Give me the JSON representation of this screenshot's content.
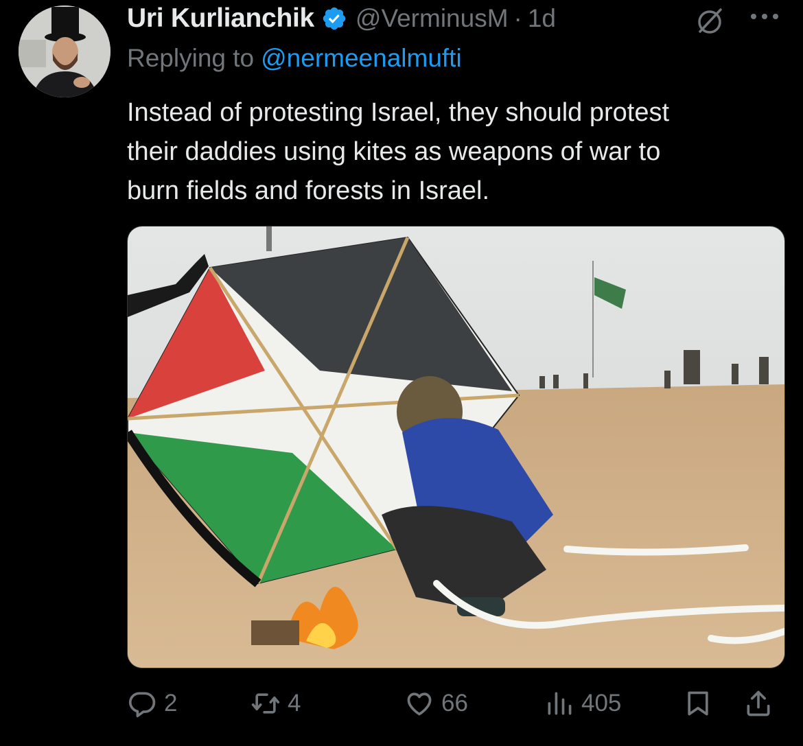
{
  "tweet": {
    "author_name": "Uri Kurlianchik",
    "handle": "@VerminusM",
    "separator": "·",
    "time": "1d",
    "replying_prefix": "Replying to",
    "replying_to": "@nermeenalmufti",
    "text_lines": [
      "Instead of protesting Israel, they should protest",
      "their daddies using kites as weapons of war to",
      "burn fields and forests in Israel."
    ]
  },
  "metrics": {
    "replies": "2",
    "reposts": "4",
    "likes": "66",
    "views": "405"
  },
  "icons": {
    "verified": "verified-badge-icon",
    "grok": "grok-icon",
    "more": "more-icon",
    "reply": "reply-icon",
    "repost": "repost-icon",
    "like": "heart-icon",
    "views": "views-icon",
    "bookmark": "bookmark-icon",
    "share": "share-icon"
  },
  "colors": {
    "background": "#000000",
    "text_primary": "#e7e9ea",
    "text_secondary": "#71767b",
    "accent": "#1d9bf0"
  }
}
